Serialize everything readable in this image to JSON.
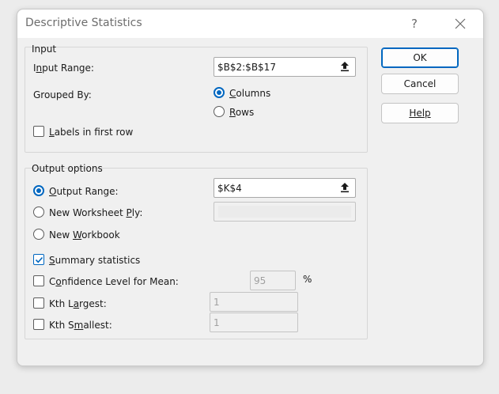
{
  "dialog": {
    "title": "Descriptive Statistics",
    "help_glyph": "?",
    "close_glyph": "✕"
  },
  "input": {
    "legend": "Input",
    "range_label_pre": "I",
    "range_label_accel": "n",
    "range_label_post": "put Range:",
    "range_value": "$B$2:$B$17",
    "grouped_by_label": "Grouped By:",
    "columns_accel": "C",
    "columns_rest": "olumns",
    "rows_accel": "R",
    "rows_rest": "ows",
    "labels_accel": "L",
    "labels_rest": "abels in first row"
  },
  "output": {
    "legend": "Output options",
    "output_range_accel": "O",
    "output_range_rest": "utput Range:",
    "output_range_value": "$K$4",
    "new_ply_pre": "New Worksheet ",
    "new_ply_accel": "P",
    "new_ply_post": "ly:",
    "new_workbook_pre": "New ",
    "new_workbook_accel": "W",
    "new_workbook_post": "orkbook",
    "summary_accel": "S",
    "summary_rest": "ummary statistics",
    "confidence_pre": "C",
    "confidence_accel": "o",
    "confidence_post": "nfidence Level for Mean:",
    "confidence_value": "95",
    "percent": "%",
    "kth_largest_pre": "Kth L",
    "kth_largest_accel": "a",
    "kth_largest_post": "rgest:",
    "kth_largest_value": "1",
    "kth_smallest_pre": "Kth S",
    "kth_smallest_accel": "m",
    "kth_smallest_post": "allest:",
    "kth_smallest_value": "1"
  },
  "buttons": {
    "ok": "OK",
    "cancel": "Cancel",
    "help": "Help"
  },
  "state": {
    "grouped_by": "Columns",
    "labels_in_first_row": false,
    "output_option": "Output Range",
    "summary_statistics": true,
    "confidence_level": false,
    "kth_largest": false,
    "kth_smallest": false
  },
  "icons": {
    "range_select": "collapse-dialog-arrow-icon"
  },
  "colors": {
    "accent": "#0067c0"
  }
}
